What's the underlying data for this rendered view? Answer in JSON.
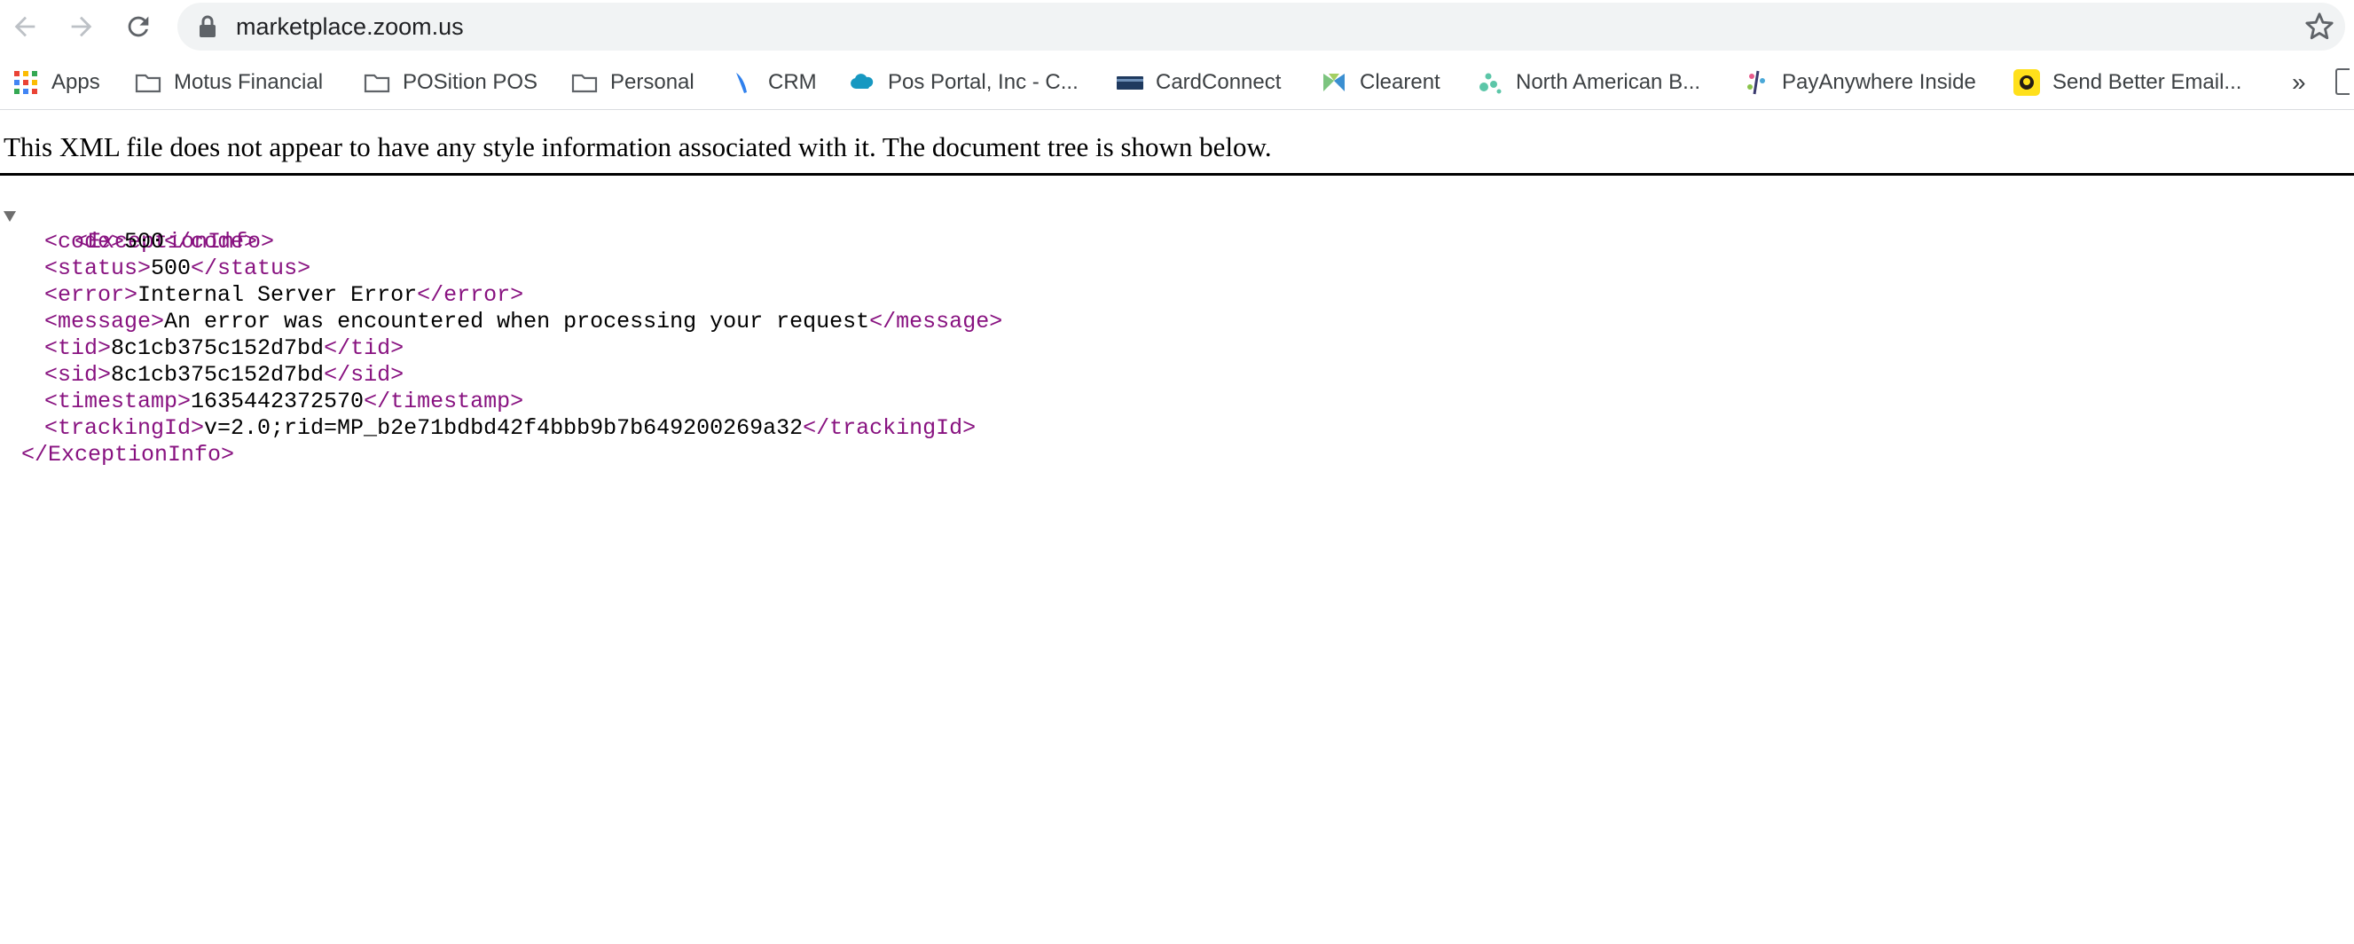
{
  "browser": {
    "url": "marketplace.zoom.us",
    "icons": {
      "back": "arrow-left-icon",
      "forward": "arrow-right-icon",
      "reload": "reload-icon",
      "lock": "lock-icon",
      "bookmark_star": "star-outline-icon",
      "more": "chevron-double-right-icon"
    },
    "bookmarks": [
      {
        "label": "Apps",
        "icon": "apps-grid-icon"
      },
      {
        "label": "Motus Financial",
        "icon": "folder-icon"
      },
      {
        "label": "POSition POS",
        "icon": "folder-icon"
      },
      {
        "label": "Personal",
        "icon": "folder-icon"
      },
      {
        "label": "CRM",
        "icon": "crm-feather-icon"
      },
      {
        "label": "Pos Portal, Inc - C...",
        "icon": "cloud-icon"
      },
      {
        "label": "CardConnect",
        "icon": "card-icon"
      },
      {
        "label": "Clearent",
        "icon": "clearent-logo-icon"
      },
      {
        "label": "North American B...",
        "icon": "dots-logo-icon"
      },
      {
        "label": "PayAnywhere Inside",
        "icon": "payanywhere-logo-icon"
      },
      {
        "label": "Send Better Email...",
        "icon": "mailchimp-logo-icon"
      }
    ],
    "more_label": "»"
  },
  "page": {
    "info_message": "This XML file does not appear to have any style information associated with it. The document tree is shown below.",
    "xml": {
      "root_open": "<ExceptionInfo>",
      "root_close": "</ExceptionInfo>",
      "children": [
        {
          "open": "<code>",
          "value": "500",
          "close": "</code>"
        },
        {
          "open": "<status>",
          "value": "500",
          "close": "</status>"
        },
        {
          "open": "<error>",
          "value": "Internal Server Error",
          "close": "</error>"
        },
        {
          "open": "<message>",
          "value": "An error was encountered when processing your request",
          "close": "</message>"
        },
        {
          "open": "<tid>",
          "value": "8c1cb375c152d7bd",
          "close": "</tid>"
        },
        {
          "open": "<sid>",
          "value": "8c1cb375c152d7bd",
          "close": "</sid>"
        },
        {
          "open": "<timestamp>",
          "value": "1635442372570",
          "close": "</timestamp>"
        },
        {
          "open": "<trackingId>",
          "value": "v=2.0;rid=MP_b2e71bdbd42f4bbb9b7b649200269a32",
          "close": "</trackingId>"
        }
      ]
    }
  },
  "colors": {
    "tag": "#881280",
    "text": "#000000",
    "omnibox_bg": "#f1f3f4"
  }
}
